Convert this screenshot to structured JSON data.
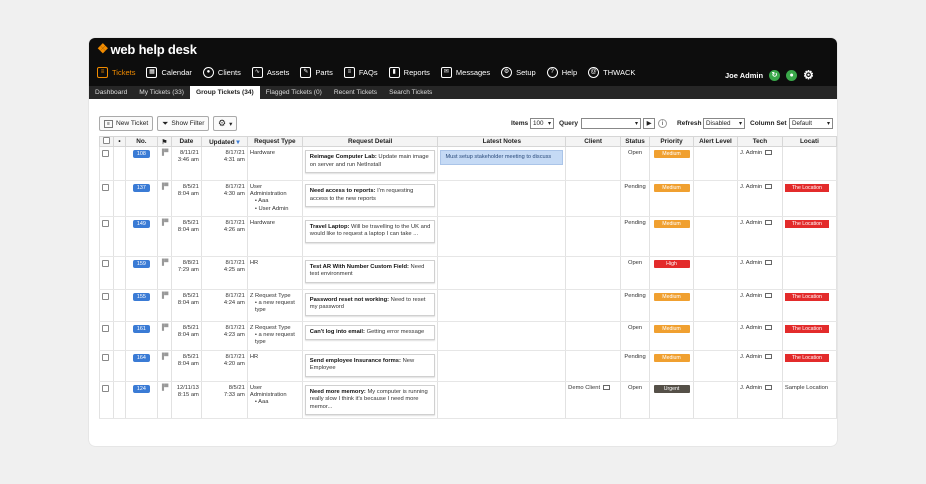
{
  "app": {
    "logo": "web help desk"
  },
  "nav": [
    {
      "label": "Tickets",
      "icon": "tickets-icon",
      "glyph": "≡",
      "active": true
    },
    {
      "label": "Calendar",
      "icon": "calendar-icon",
      "glyph": "▦"
    },
    {
      "label": "Clients",
      "icon": "clients-icon",
      "glyph": "●"
    },
    {
      "label": "Assets",
      "icon": "assets-icon",
      "glyph": "∿"
    },
    {
      "label": "Parts",
      "icon": "parts-icon",
      "glyph": "✎"
    },
    {
      "label": "FAQs",
      "icon": "faqs-icon",
      "glyph": "≡"
    },
    {
      "label": "Reports",
      "icon": "reports-icon",
      "glyph": "▮"
    },
    {
      "label": "Messages",
      "icon": "messages-icon",
      "glyph": "✉"
    },
    {
      "label": "Setup",
      "icon": "setup-icon",
      "glyph": "⚙"
    },
    {
      "label": "Help",
      "icon": "help-icon",
      "glyph": "?"
    },
    {
      "label": "THWACK",
      "icon": "thwack-icon",
      "glyph": "@"
    }
  ],
  "user": {
    "name": "Joe Admin"
  },
  "subnav": [
    {
      "label": "Dashboard"
    },
    {
      "label": "My Tickets (33)"
    },
    {
      "label": "Group Tickets (34)",
      "active": true
    },
    {
      "label": "Flagged Tickets (0)"
    },
    {
      "label": "Recent Tickets"
    },
    {
      "label": "Search Tickets"
    }
  ],
  "toolbar": {
    "new_ticket": "New Ticket",
    "show_filter": "Show Filter",
    "items_label": "Items",
    "items_value": "100",
    "query_label": "Query",
    "query_value": "",
    "refresh_label": "Refresh",
    "refresh_value": "Disabled",
    "column_set_label": "Column Set",
    "column_set_value": "Default"
  },
  "columns": {
    "no": "No.",
    "date": "Date",
    "updated": "Updated",
    "request_type": "Request Type",
    "request_detail": "Request Detail",
    "latest_notes": "Latest Notes",
    "client": "Client",
    "status": "Status",
    "priority": "Priority",
    "alert_level": "Alert Level",
    "tech": "Tech",
    "location": "Locati"
  },
  "colors": {
    "Medium": "#f0a030",
    "High": "#e32b2b",
    "Urgent": "#555048",
    "location": "#e32b2b"
  },
  "tickets": [
    {
      "no": "108",
      "date": [
        "8/11/21",
        "3:46 am"
      ],
      "updated": [
        "8/17/21",
        "4:31 am"
      ],
      "type": "Hardware",
      "type_sub": [],
      "detail_title": "Reimage Computer Lab:",
      "detail_text": " Update main image on server and run NetInstall",
      "note": "Must setup stakeholder meeting to discuss",
      "client": "",
      "status": "Open",
      "priority": "Medium",
      "tech": "J. Admin",
      "location": ""
    },
    {
      "no": "137",
      "date": [
        "8/5/21",
        "8:04 am"
      ],
      "updated": [
        "8/17/21",
        "4:30 am"
      ],
      "type": "User Administration",
      "type_sub": [
        "Aaa",
        "User Admin"
      ],
      "detail_title": "Need access to reports:",
      "detail_text": " I'm requesting access to the new reports",
      "note": "",
      "client": "",
      "status": "Pending",
      "priority": "Medium",
      "tech": "J. Admin",
      "location": "The Location"
    },
    {
      "no": "149",
      "date": [
        "8/5/21",
        "8:04 am"
      ],
      "updated": [
        "8/17/21",
        "4:26 am"
      ],
      "type": "Hardware",
      "type_sub": [],
      "detail_title": "Travel Laptop:",
      "detail_text": " Will be travelling to the UK and would like to request a laptop I can take ...",
      "note": "",
      "client": "",
      "status": "Pending",
      "priority": "Medium",
      "tech": "J. Admin",
      "location": "The Location"
    },
    {
      "no": "159",
      "date": [
        "8/8/21",
        "7:29 am"
      ],
      "updated": [
        "8/17/21",
        "4:25 am"
      ],
      "type": "HR",
      "type_sub": [],
      "detail_title": "Test AR With Number Custom Field:",
      "detail_text": " Need test environment",
      "note": "",
      "client": "",
      "status": "Open",
      "priority": "High",
      "tech": "J. Admin",
      "location": ""
    },
    {
      "no": "155",
      "date": [
        "8/5/21",
        "8:04 am"
      ],
      "updated": [
        "8/17/21",
        "4:24 am"
      ],
      "type": "Z Request Type",
      "type_sub": [
        "a new request type"
      ],
      "detail_title": "Password reset not working:",
      "detail_text": " Need to reset my password",
      "note": "",
      "client": "",
      "status": "Pending",
      "priority": "Medium",
      "tech": "J. Admin",
      "location": "The Location"
    },
    {
      "no": "161",
      "date": [
        "8/5/21",
        "8:04 am"
      ],
      "updated": [
        "8/17/21",
        "4:23 am"
      ],
      "type": "Z Request Type",
      "type_sub": [
        "a new request type"
      ],
      "detail_title": "Can't log into email:",
      "detail_text": " Getting error message",
      "note": "",
      "client": "",
      "status": "Open",
      "priority": "Medium",
      "tech": "J. Admin",
      "location": "The Location"
    },
    {
      "no": "164",
      "date": [
        "8/5/21",
        "8:04 am"
      ],
      "updated": [
        "8/17/21",
        "4:20 am"
      ],
      "type": "HR",
      "type_sub": [],
      "detail_title": "Send employee Insurance forms:",
      "detail_text": " New Employee",
      "note": "",
      "client": "",
      "status": "Pending",
      "priority": "Medium",
      "tech": "J. Admin",
      "location": "The Location"
    },
    {
      "no": "124",
      "date": [
        "12/11/13",
        "8:15 am"
      ],
      "updated": [
        "8/5/21",
        "7:33 am"
      ],
      "type": "User Administration",
      "type_sub": [
        "Aaa"
      ],
      "detail_title": "Need more memory:",
      "detail_text": " My computer is running​really slow I think it's because I need more memor...",
      "note": "",
      "client": "Demo Client",
      "status": "Open",
      "priority": "Urgent",
      "tech": "J. Admin",
      "location": "Sample Location",
      "location_plain": true
    }
  ]
}
